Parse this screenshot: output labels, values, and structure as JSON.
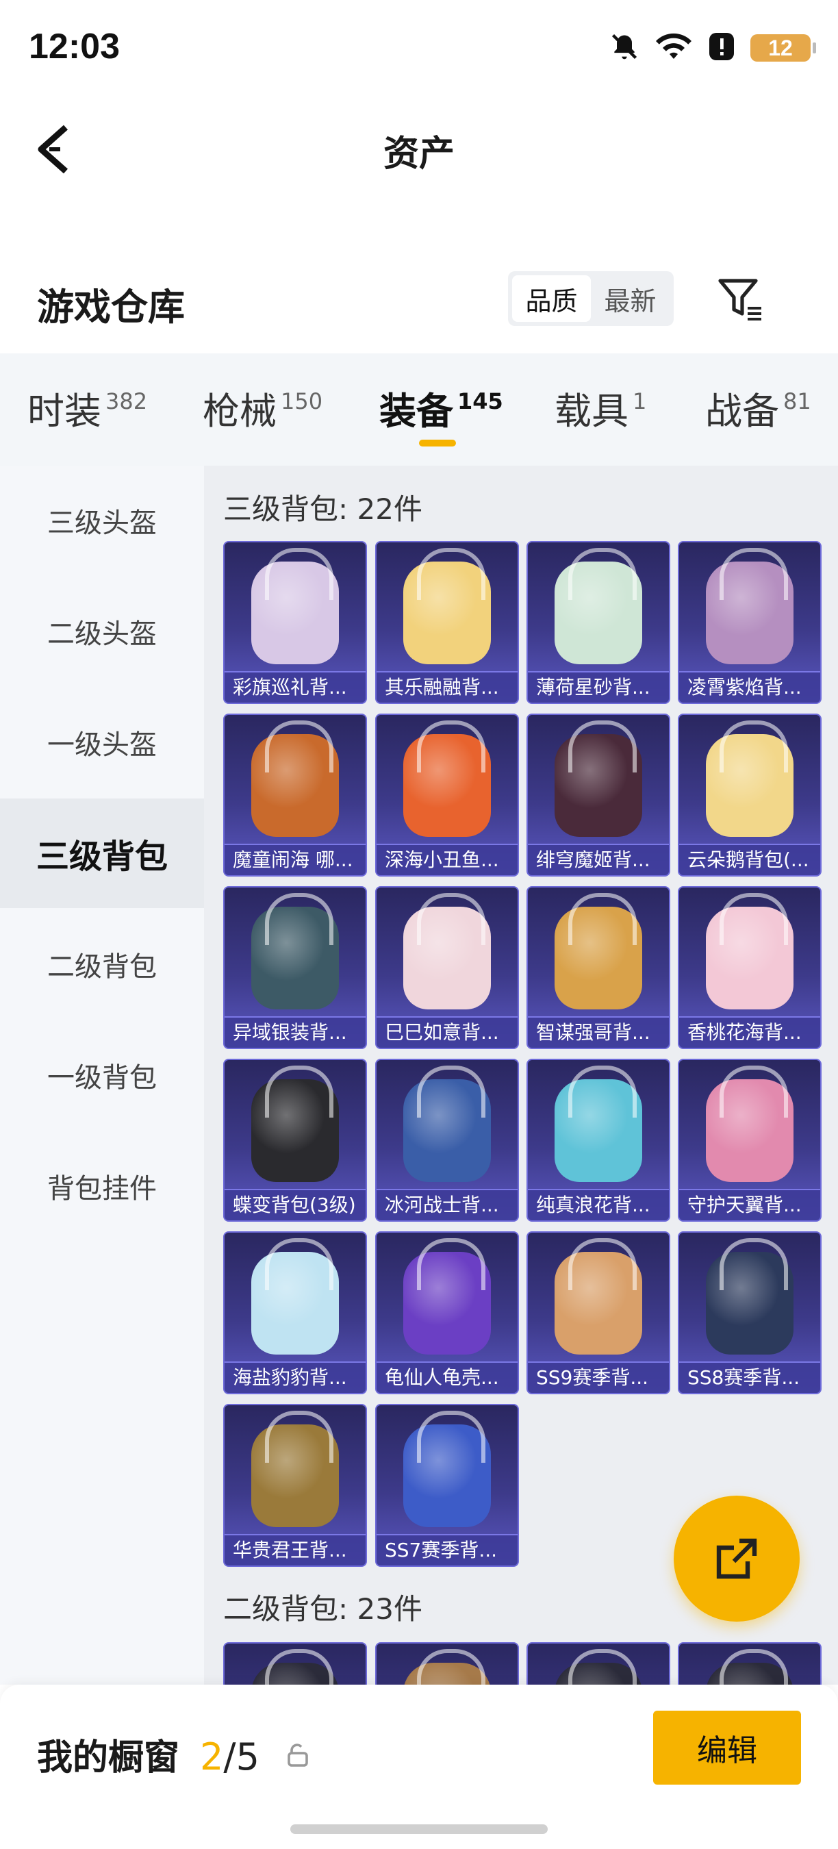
{
  "status": {
    "time": "12:03",
    "battery": "12"
  },
  "header": {
    "title": "资产"
  },
  "warehouse": {
    "title": "游戏仓库",
    "sort_options": [
      {
        "label": "品质",
        "active": true
      },
      {
        "label": "最新",
        "active": false
      }
    ]
  },
  "tabs": [
    {
      "label": "时装",
      "count": "382"
    },
    {
      "label": "枪械",
      "count": "150"
    },
    {
      "label": "装备",
      "count": "145",
      "active": true
    },
    {
      "label": "载具",
      "count": "1"
    },
    {
      "label": "战备",
      "count": "81"
    }
  ],
  "sidebar": [
    {
      "label": "三级头盔"
    },
    {
      "label": "二级头盔"
    },
    {
      "label": "一级头盔"
    },
    {
      "label": "三级背包",
      "active": true
    },
    {
      "label": "二级背包"
    },
    {
      "label": "一级背包"
    },
    {
      "label": "背包挂件"
    }
  ],
  "sections": [
    {
      "title": "三级背包: 22件",
      "items": [
        {
          "name": "彩旗巡礼背...",
          "color": "#d8c8e6"
        },
        {
          "name": "其乐融融背...",
          "color": "#f2d27c"
        },
        {
          "name": "薄荷星砂背...",
          "color": "#cfe6d6"
        },
        {
          "name": "凌霄紫焰背...",
          "color": "#b58fc0"
        },
        {
          "name": "魔童闹海 哪...",
          "color": "#c96a2c"
        },
        {
          "name": "深海小丑鱼...",
          "color": "#e8632e"
        },
        {
          "name": "绯穹魔姬背...",
          "color": "#4a2a3a"
        },
        {
          "name": "云朵鹅背包(...",
          "color": "#f2d78a"
        },
        {
          "name": "异域银装背...",
          "color": "#3d5a66"
        },
        {
          "name": "巳巳如意背...",
          "color": "#f0d6dc"
        },
        {
          "name": "智谋强哥背...",
          "color": "#d9a24a"
        },
        {
          "name": "香桃花海背...",
          "color": "#f3c8d6"
        },
        {
          "name": "蝶变背包(3级)",
          "color": "#2a2a2e"
        },
        {
          "name": "冰河战士背...",
          "color": "#3a5ea8"
        },
        {
          "name": "纯真浪花背...",
          "color": "#5fc3d8"
        },
        {
          "name": "守护天翼背...",
          "color": "#e28aae"
        },
        {
          "name": "海盐豹豹背...",
          "color": "#bfe3f2"
        },
        {
          "name": "龟仙人龟壳...",
          "color": "#6b3fc4"
        },
        {
          "name": "SS9赛季背...",
          "color": "#d9a06a"
        },
        {
          "name": "SS8赛季背...",
          "color": "#2c3a5c"
        },
        {
          "name": "华贵君王背...",
          "color": "#9a7a3a"
        },
        {
          "name": "SS7赛季背...",
          "color": "#3d5cc8"
        }
      ]
    },
    {
      "title": "二级背包: 23件",
      "items": [
        {
          "name": "",
          "color": "#2b2b3a"
        },
        {
          "name": "",
          "color": "#a67a4a"
        },
        {
          "name": "",
          "color": "#2b2b3a"
        },
        {
          "name": "",
          "color": "#2b2b3a"
        }
      ]
    }
  ],
  "showcase": {
    "title": "我的橱窗",
    "current": "2",
    "separator": "/",
    "total": "5"
  },
  "edit_label": "编辑"
}
